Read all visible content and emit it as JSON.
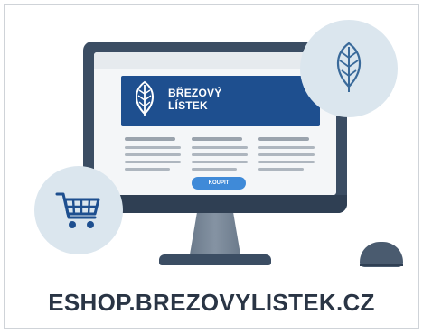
{
  "banner": {
    "title": "BŘEZOVÝ\nLÍSTEK"
  },
  "buy_button": {
    "label": "KOUPIT"
  },
  "footer": {
    "url": "ESHOP.BREZOVYLISTEK.CZ"
  },
  "icons": {
    "leaf": "leaf-icon",
    "cart": "shopping-cart-icon"
  },
  "colors": {
    "monitor": "#3b4d63",
    "banner": "#1e4f8f",
    "button": "#3f8ad8",
    "circle": "#dbe6ee",
    "footer_text": "#2a3545"
  }
}
